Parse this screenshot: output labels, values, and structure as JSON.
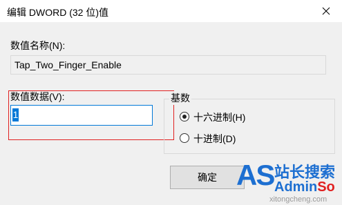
{
  "window": {
    "title": "编辑 DWORD (32 位)值"
  },
  "value_name": {
    "label": "数值名称(N):",
    "value": "Tap_Two_Finger_Enable"
  },
  "value_data": {
    "label": "数值数据(V):",
    "value": "1"
  },
  "base": {
    "title": "基数",
    "options": [
      {
        "label": "十六进制(H)",
        "selected": true
      },
      {
        "label": "十进制(D)",
        "selected": false
      }
    ]
  },
  "buttons": {
    "ok_label": "确定"
  },
  "watermark": {
    "logo": "AS",
    "site_name": "站长搜索",
    "brand_admin": "Admin",
    "brand_so": "So",
    "url": "xitongcheng.com"
  },
  "colors": {
    "accent": "#0078d7",
    "highlight_box": "#e02020",
    "dialog_bg": "#f0f0f0"
  }
}
